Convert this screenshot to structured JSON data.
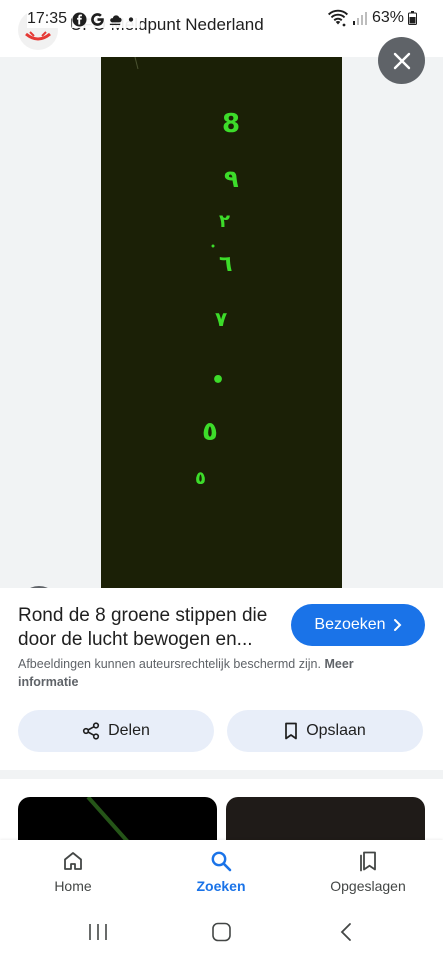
{
  "status_bar": {
    "time": "17:35",
    "battery": "63%",
    "notification_icons": [
      "facebook-icon",
      "google-icon",
      "weather-icon",
      "dot-icon"
    ]
  },
  "site": {
    "name": "UFO Meldpunt Nederland"
  },
  "viewer": {
    "photo_background": "#1b2006",
    "glyph_color": "#3ddc2a",
    "glyphs": [
      "8",
      "٩",
      "٢",
      "٦",
      "٧",
      "•",
      "٥",
      "٥"
    ]
  },
  "result": {
    "title": "Rond de 8 groene stippen die door de lucht bewogen en...",
    "visit_label": "Bezoeken",
    "copyright_text": "Afbeeldingen kunnen auteursrechtelijk beschermd zijn.",
    "more_info_label": "Meer informatie"
  },
  "actions": {
    "share_label": "Delen",
    "save_label": "Opslaan"
  },
  "bottom_nav": {
    "items": [
      {
        "label": "Home",
        "icon": "home-icon"
      },
      {
        "label": "Zoeken",
        "icon": "search-icon",
        "active": true
      },
      {
        "label": "Opgeslagen",
        "icon": "bookmarks-icon"
      }
    ]
  },
  "colors": {
    "accent": "#1a73e8",
    "chip_background": "#e8eef9",
    "overlay_button": "#5f6368"
  }
}
